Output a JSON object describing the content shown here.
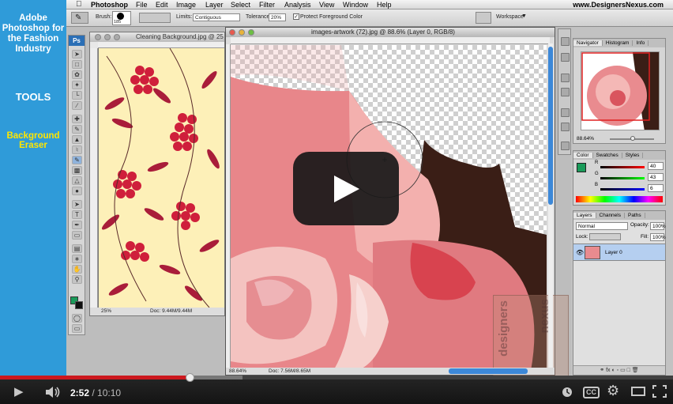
{
  "sidebar": {
    "title": "Adobe Photoshop for the Fashion Industry",
    "section": "TOOLS",
    "tool": "Background Eraser"
  },
  "menubar": {
    "app": "Photoshop",
    "items": [
      "File",
      "Edit",
      "Image",
      "Layer",
      "Select",
      "Filter",
      "Analysis",
      "View",
      "Window",
      "Help"
    ],
    "site": "www.DesignersNexus.com"
  },
  "options": {
    "brush_label": "Brush:",
    "brush_size": "185",
    "limits_label": "Limits:",
    "limits_value": "Contiguous",
    "tolerance_label": "Tolerance:",
    "tolerance_value": "20%",
    "protect_label": "Protect Foreground Color",
    "workspace_label": "Workspace"
  },
  "doc1": {
    "title": "Cleaning Background.jpg @ 25",
    "zoom": "25%",
    "doc": "Doc: 9.44M/9.44M"
  },
  "doc2": {
    "title": "images-artwork (72).jpg @ 88.6% (Layer 0, RGB/8)",
    "zoom": "88.64%",
    "doc": "Doc: 7.56M/8.65M"
  },
  "navigator": {
    "tabs": [
      "Navigator",
      "Histogram",
      "Info"
    ],
    "zoom": "88.64%"
  },
  "color": {
    "tabs": [
      "Color",
      "Swatches",
      "Styles"
    ],
    "r_label": "R",
    "g_label": "G",
    "b_label": "B",
    "r": "40",
    "g": "43",
    "b": "6",
    "fg_color": "#1a9b5a"
  },
  "layers": {
    "tabs": [
      "Layers",
      "Channels",
      "Paths"
    ],
    "blend": "Normal",
    "opacity_label": "Opacity:",
    "opacity": "100%",
    "lock_label": "Lock:",
    "fill_label": "Fill:",
    "fill": "100%",
    "layer_name": "Layer 0"
  },
  "watermark": {
    "brand": "designers",
    "brand2": "nexus"
  },
  "player": {
    "current": "2:52",
    "separator": " / ",
    "total": "10:10",
    "progress": 0.282,
    "buffered": 0.36,
    "accent": "#cc181e"
  }
}
